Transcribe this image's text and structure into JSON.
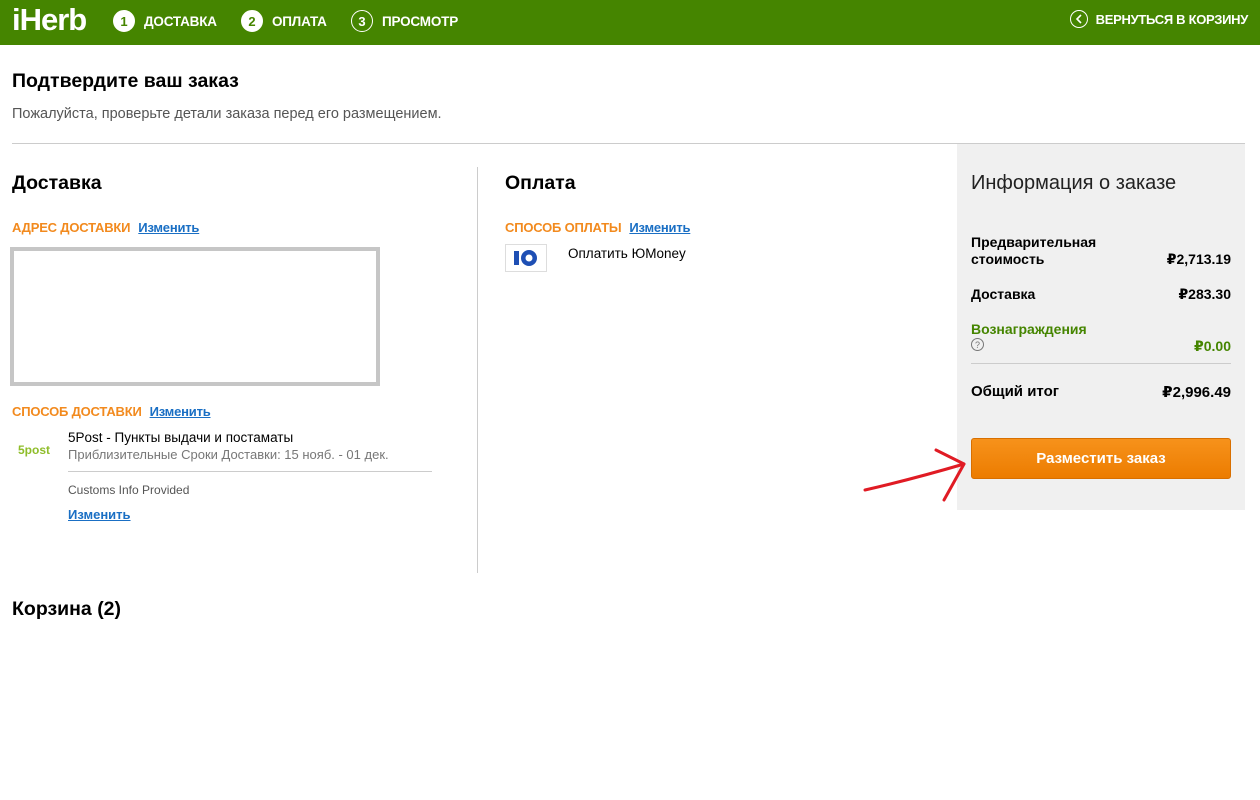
{
  "header": {
    "logo": "iHerb",
    "steps": [
      {
        "num": "1",
        "label": "ДОСТАВКА"
      },
      {
        "num": "2",
        "label": "ОПЛАТА"
      },
      {
        "num": "3",
        "label": "ПРОСМОТР"
      }
    ],
    "back_label": "ВЕРНУТЬСЯ В КОРЗИНУ"
  },
  "page": {
    "title": "Подтвердите ваш заказ",
    "subtitle": "Пожалуйста, проверьте детали заказа перед его размещением."
  },
  "shipping": {
    "title": "Доставка",
    "address_label": "АДРЕС ДОСТАВКИ",
    "address_change": "Изменить",
    "method_label": "СПОСОБ ДОСТАВКИ",
    "method_change": "Изменить",
    "carrier_logo": "5post",
    "carrier_name": "5Post - Пункты выдачи и постаматы",
    "eta": "Приблизительные Сроки Доставки: 15 нояб. - 01 дек.",
    "customs": "Customs Info Provided",
    "customs_change": "Изменить"
  },
  "payment": {
    "title": "Оплата",
    "method_label": "СПОСОБ ОПЛАТЫ",
    "method_change": "Изменить",
    "method_name": "Оплатить ЮMoney",
    "method_icon": "yoomoney-logo"
  },
  "summary": {
    "title": "Информация о заказе",
    "subtotal_label": "Предварительная стоимость",
    "subtotal_value": "₽2,713.19",
    "shipping_label": "Доставка",
    "shipping_value": "₽283.30",
    "rewards_label": "Вознаграждения",
    "rewards_value": "₽0.00",
    "total_label": "Общий итог",
    "total_value": "₽2,996.49",
    "place_order": "Разместить заказ"
  },
  "cart": {
    "title": "Корзина (2)"
  },
  "colors": {
    "topbar": "#458500",
    "accent_orange": "#f28a1e",
    "link": "#1a6fc4",
    "button": "#f28a1e",
    "annotation_arrow": "#e01b24"
  }
}
